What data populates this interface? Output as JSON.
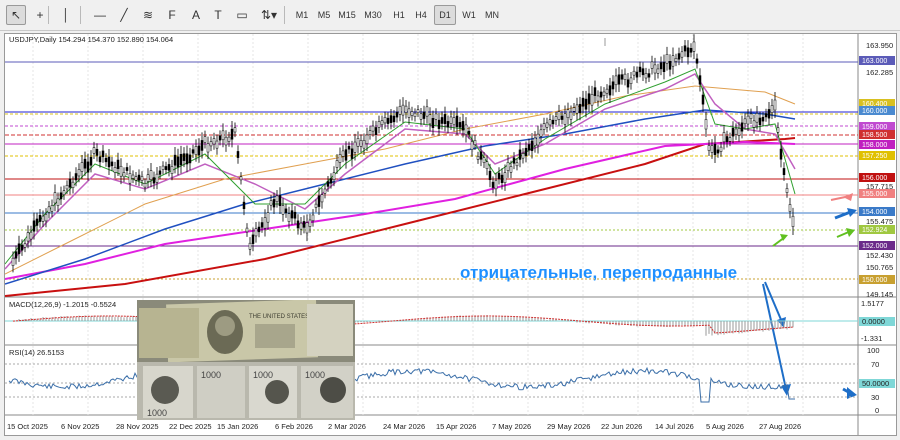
{
  "toolbar": {
    "tools": [
      {
        "name": "cursor-icon",
        "glyph": "↖"
      },
      {
        "name": "crosshair-icon",
        "glyph": "+"
      },
      {
        "name": "vertical-line-icon",
        "glyph": "│"
      },
      {
        "name": "horizontal-line-icon",
        "glyph": "—"
      },
      {
        "name": "trendline-icon",
        "glyph": "╱"
      },
      {
        "name": "channel-icon",
        "glyph": "≋"
      },
      {
        "name": "fibonacci-icon",
        "glyph": "F"
      },
      {
        "name": "text-icon",
        "glyph": "A"
      },
      {
        "name": "label-icon",
        "glyph": "T"
      },
      {
        "name": "shapes-icon",
        "glyph": "▭"
      },
      {
        "name": "arrows-icon",
        "glyph": "⇅▾"
      }
    ],
    "timeframes": [
      "M1",
      "M5",
      "M15",
      "M30",
      "H1",
      "H4",
      "D1",
      "W1",
      "MN"
    ],
    "active_timeframe": "D1"
  },
  "chart": {
    "header": "USDJPY,Daily  154.294 154.370 152.890 154.064",
    "price_labels": [
      "163.950",
      "162.285",
      "160.450",
      "157.715",
      "155.475",
      "152.430",
      "150.765",
      "149.145"
    ],
    "level_badges": [
      {
        "text": "163.000",
        "color": "#5b5bb8"
      },
      {
        "text": "160.400",
        "color": "#d8c020"
      },
      {
        "text": "160.000",
        "color": "#4a8ad0"
      },
      {
        "text": "159.000",
        "color": "#c04ad0"
      },
      {
        "text": "158.500",
        "color": "#d03030"
      },
      {
        "text": "158.000",
        "color": "#c020c0"
      },
      {
        "text": "157.250",
        "color": "#e0c000"
      },
      {
        "text": "156.000",
        "color": "#c01010"
      },
      {
        "text": "155.000",
        "color": "#f08080"
      },
      {
        "text": "154.000",
        "color": "#3a7ac8"
      },
      {
        "text": "152.924",
        "color": "#a0c840"
      },
      {
        "text": "152.000",
        "color": "#6a2a8a"
      },
      {
        "text": "150.000",
        "color": "#c8a030"
      }
    ],
    "annotation": "отрицательные, перепроданные",
    "macd": {
      "label": "MACD(12,26,9) -1.2015 -0.5524",
      "axis": [
        "1.5177",
        "0.0000",
        "-1.331"
      ]
    },
    "rsi": {
      "label": "RSI(14) 26.5153",
      "axis": [
        "100",
        "70",
        "50.0000",
        "30",
        "0"
      ]
    },
    "dates": [
      "15 Oct 2025",
      "6 Nov 2025",
      "28 Nov 2025",
      "22 Dec 2025",
      "15 Jan 2026",
      "6 Feb 2026",
      "2 Mar 2026",
      "24 Mar 2026",
      "15 Apr 2026",
      "7 May 2026",
      "29 May 2026",
      "22 Jun 2026",
      "14 Jul 2026",
      "5 Aug 2026",
      "27 Aug 2026"
    ]
  },
  "photo": {
    "banknote_text": "THE UNITED STATES OF AMERICA",
    "yen_values": [
      "1000",
      "1000",
      "1000",
      "1000"
    ]
  }
}
